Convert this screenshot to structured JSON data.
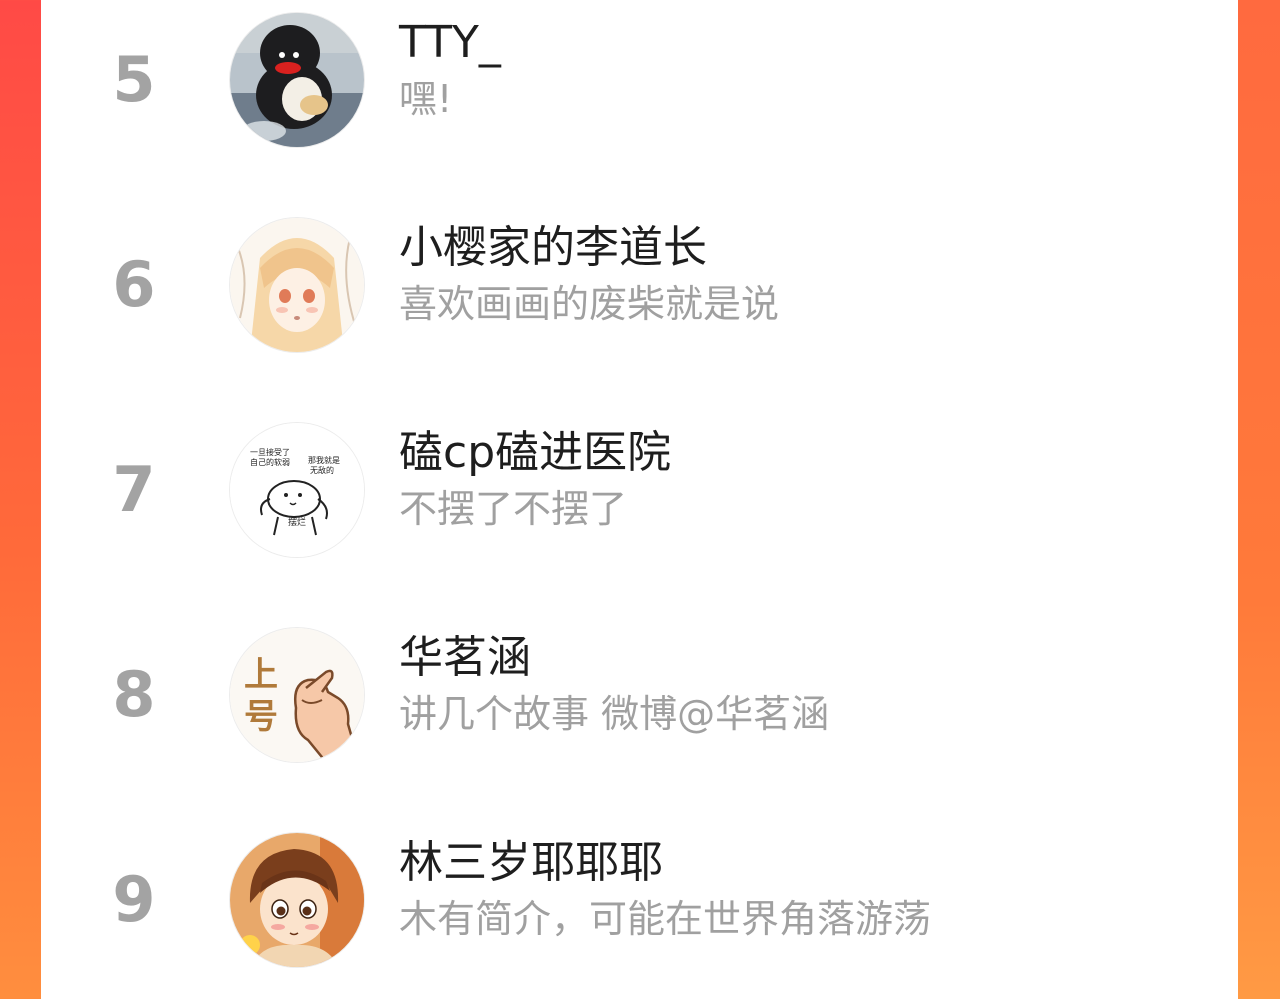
{
  "ranking": {
    "items": [
      {
        "rank": "5",
        "name": "TTY_",
        "bio": "嘿!",
        "avatar_icon": "penguin-plush-avatar"
      },
      {
        "rank": "6",
        "name": "小樱家的李道长",
        "bio": "喜欢画画的废柴就是说",
        "avatar_icon": "anime-girl-avatar"
      },
      {
        "rank": "7",
        "name": "磕cp磕进医院",
        "bio": "不摆了不摆了",
        "avatar_icon": "meme-sticker-avatar",
        "avatar_text": {
          "left_line1": "一旦接受了",
          "left_line2": "自己的软弱",
          "right_line1": "那我就是",
          "right_line2": "无敌的",
          "bottom": "摆烂"
        }
      },
      {
        "rank": "8",
        "name": "华茗涵",
        "bio": "讲几个故事 微博@华茗涵",
        "avatar_icon": "pointing-hand-avatar",
        "avatar_text": {
          "top": "上",
          "bottom": "号"
        }
      },
      {
        "rank": "9",
        "name": "林三岁耶耶耶",
        "bio": "木有简介，可能在世界角落游荡",
        "avatar_icon": "anime-boy-avatar"
      }
    ]
  },
  "colors": {
    "background_gradient_top": "#ff4a46",
    "background_gradient_bottom": "#ff8e3e",
    "rank_number": "#a3a3a3",
    "name_text": "#1e1e1e",
    "bio_text": "#a0a0a0"
  }
}
